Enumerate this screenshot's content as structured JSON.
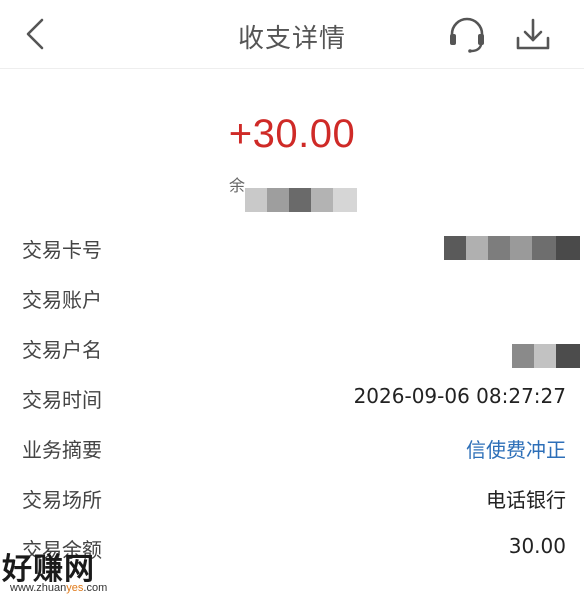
{
  "header": {
    "title": "收支详情",
    "icons": [
      "back-chevron-icon",
      "customer-service-headset-icon",
      "download-icon"
    ]
  },
  "summary": {
    "amount": "+30.00",
    "amount_color": "#cf2a27",
    "balance_prefix": "余"
  },
  "details": [
    {
      "label": "交易卡号",
      "value": ""
    },
    {
      "label": "交易账户",
      "value": ""
    },
    {
      "label": "交易户名",
      "value": ""
    },
    {
      "label": "交易时间",
      "value": "2026-09-06 08:27:27"
    },
    {
      "label": "业务摘要",
      "value": "信使费冲正"
    },
    {
      "label": "交易场所",
      "value": "电话银行"
    },
    {
      "label": "交易余额",
      "value": "30.00"
    }
  ],
  "link_color": "#2d6fb8",
  "watermark": {
    "main": "好赚网",
    "sub_prefix": "www.zhuan",
    "sub_highlight": "yes",
    "sub_suffix": ".com"
  }
}
